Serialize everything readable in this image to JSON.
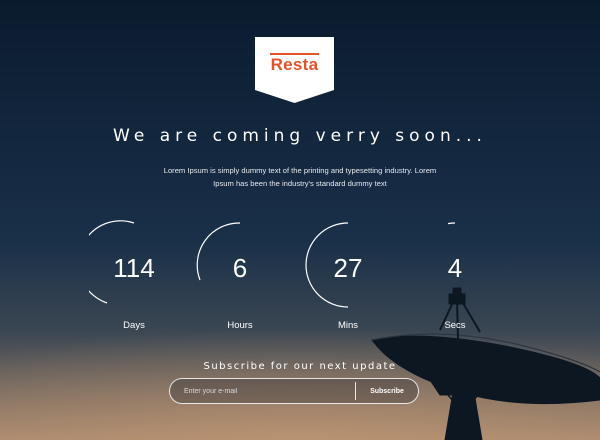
{
  "brand": {
    "name": "Resta",
    "accent_color": "#e2532b"
  },
  "hero": {
    "headline": "We are coming verry soon...",
    "description": "Lorem Ipsum is simply dummy text of the printing and typesetting industry. Lorem Ipsum has been the industry's standard dummy text"
  },
  "countdown": [
    {
      "value": "114",
      "label": "Days"
    },
    {
      "value": "6",
      "label": "Hours"
    },
    {
      "value": "27",
      "label": "Mins"
    },
    {
      "value": "4",
      "label": "Secs"
    }
  ],
  "subscribe": {
    "title": "Subscribe for our next update",
    "email_placeholder": "Enter your e-mail",
    "button_label": "Subscribe"
  },
  "background": {
    "scene": "satellite-dish-dusk"
  }
}
